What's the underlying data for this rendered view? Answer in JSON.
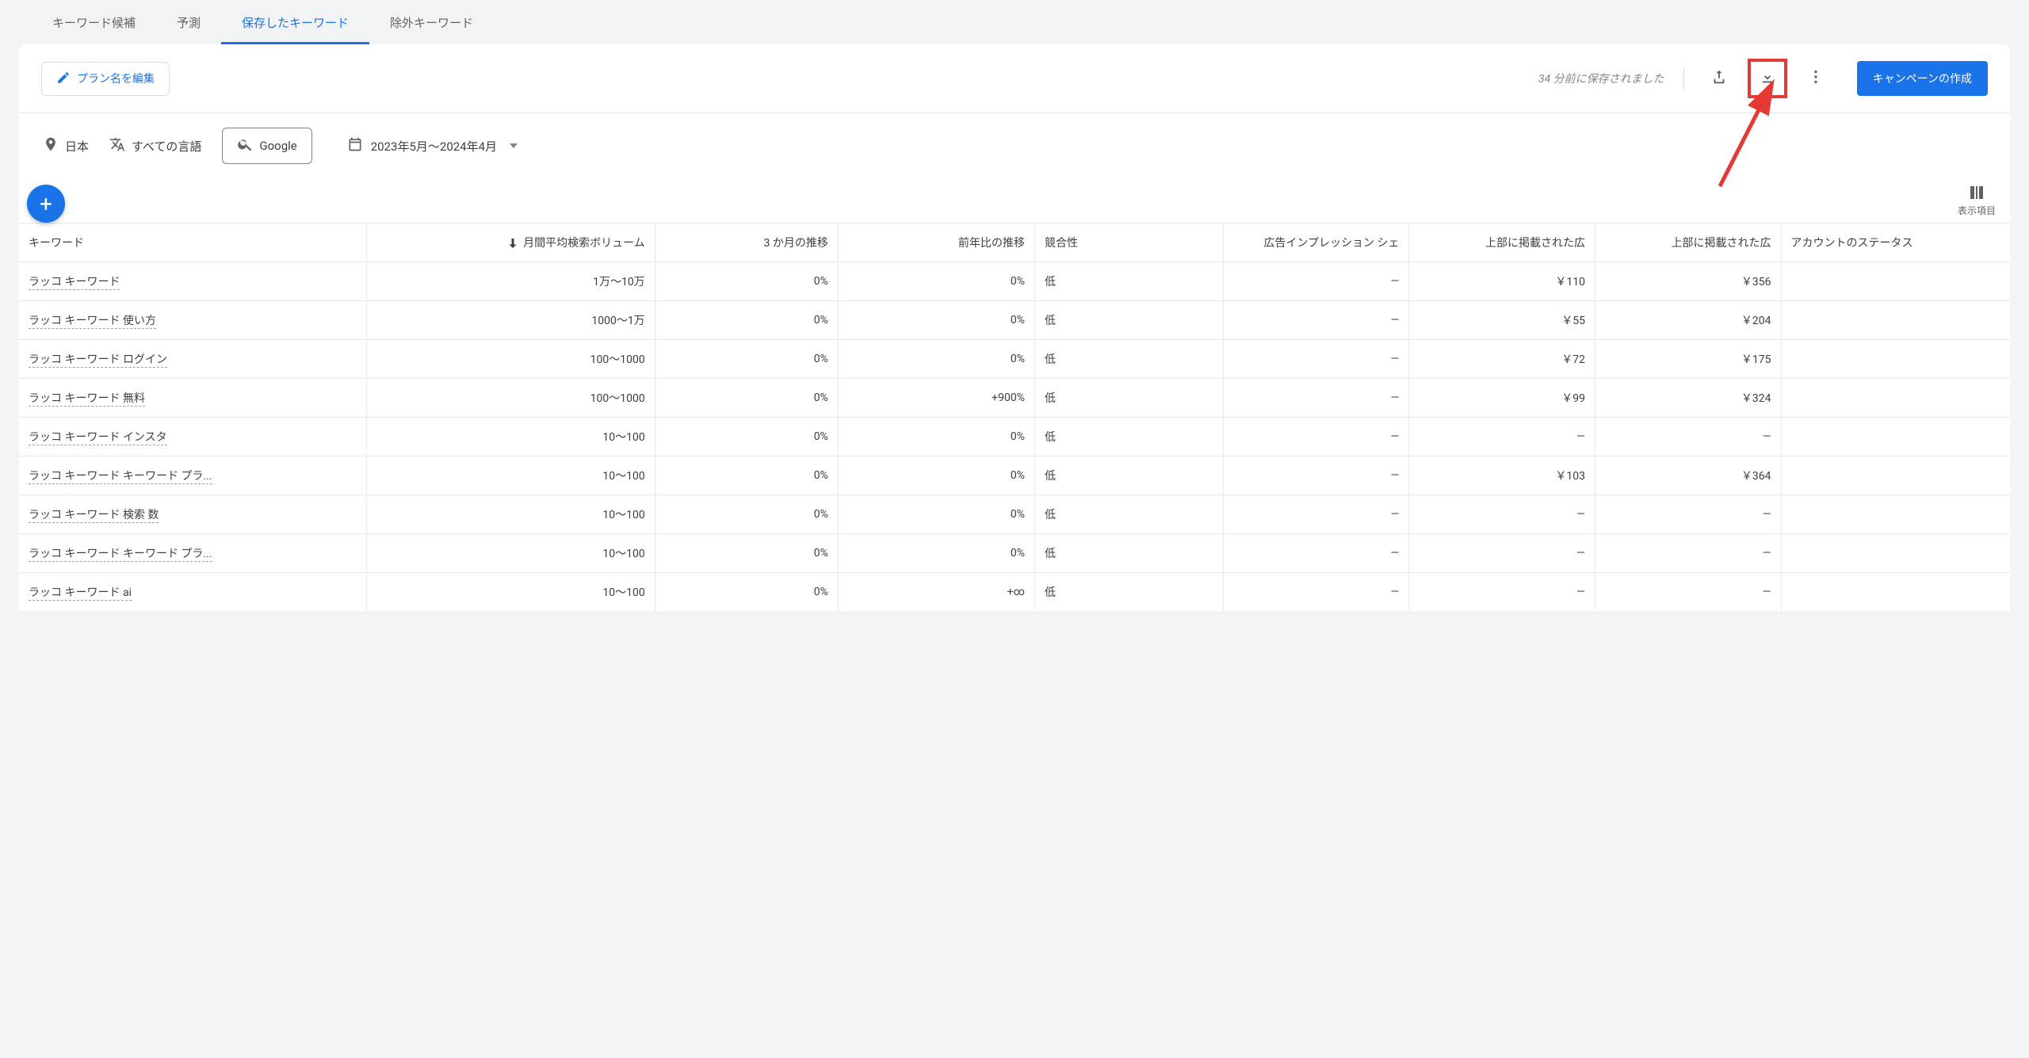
{
  "tabs": {
    "items": [
      {
        "label": "キーワード候補",
        "active": false
      },
      {
        "label": "予測",
        "active": false
      },
      {
        "label": "保存したキーワード",
        "active": true
      },
      {
        "label": "除外キーワード",
        "active": false
      }
    ]
  },
  "toolbar": {
    "edit_plan_label": "プラン名を編集",
    "saved_text": "34 分前に保存されました",
    "create_campaign_label": "キャンペーンの作成"
  },
  "filters": {
    "location": "日本",
    "language": "すべての言語",
    "network": "Google",
    "date_range": "2023年5月〜2024年4月"
  },
  "columns_toggle_label": "表示項目",
  "table": {
    "headers": {
      "keyword": "キーワード",
      "volume": "月間平均検索ボリューム",
      "trend_3mo": "3 か月の推移",
      "trend_yoy": "前年比の推移",
      "competition": "競合性",
      "ad_impr_share": "広告インプレッション シェ",
      "top_bid_low": "上部に掲載された広",
      "top_bid_high": "上部に掲載された広",
      "account_status": "アカウントのステータス"
    },
    "rows": [
      {
        "keyword": "ラッコ キーワード",
        "volume": "1万〜10万",
        "trend_3mo": "0%",
        "trend_yoy": "0%",
        "competition": "低",
        "ad_impr": "—",
        "bid_low": "￥110",
        "bid_high": "￥356",
        "status": ""
      },
      {
        "keyword": "ラッコ キーワード 使い方",
        "volume": "1000〜1万",
        "trend_3mo": "0%",
        "trend_yoy": "0%",
        "competition": "低",
        "ad_impr": "—",
        "bid_low": "￥55",
        "bid_high": "￥204",
        "status": ""
      },
      {
        "keyword": "ラッコ キーワード ログイン",
        "volume": "100〜1000",
        "trend_3mo": "0%",
        "trend_yoy": "0%",
        "competition": "低",
        "ad_impr": "—",
        "bid_low": "￥72",
        "bid_high": "￥175",
        "status": ""
      },
      {
        "keyword": "ラッコ キーワード 無料",
        "volume": "100〜1000",
        "trend_3mo": "0%",
        "trend_yoy": "+900%",
        "competition": "低",
        "ad_impr": "—",
        "bid_low": "￥99",
        "bid_high": "￥324",
        "status": ""
      },
      {
        "keyword": "ラッコ キーワード インスタ",
        "volume": "10〜100",
        "trend_3mo": "0%",
        "trend_yoy": "0%",
        "competition": "低",
        "ad_impr": "—",
        "bid_low": "—",
        "bid_high": "—",
        "status": ""
      },
      {
        "keyword": "ラッコ キーワード キーワード プラ...",
        "volume": "10〜100",
        "trend_3mo": "0%",
        "trend_yoy": "0%",
        "competition": "低",
        "ad_impr": "—",
        "bid_low": "￥103",
        "bid_high": "￥364",
        "status": ""
      },
      {
        "keyword": "ラッコ キーワード 検索 数",
        "volume": "10〜100",
        "trend_3mo": "0%",
        "trend_yoy": "0%",
        "competition": "低",
        "ad_impr": "—",
        "bid_low": "—",
        "bid_high": "—",
        "status": ""
      },
      {
        "keyword": "ラッコ キーワード キーワード プラ...",
        "volume": "10〜100",
        "trend_3mo": "0%",
        "trend_yoy": "0%",
        "competition": "低",
        "ad_impr": "—",
        "bid_low": "—",
        "bid_high": "—",
        "status": ""
      },
      {
        "keyword": "ラッコ キーワード ai",
        "volume": "10〜100",
        "trend_3mo": "0%",
        "trend_yoy": "+∞",
        "competition": "低",
        "ad_impr": "—",
        "bid_low": "—",
        "bid_high": "—",
        "status": ""
      }
    ]
  }
}
